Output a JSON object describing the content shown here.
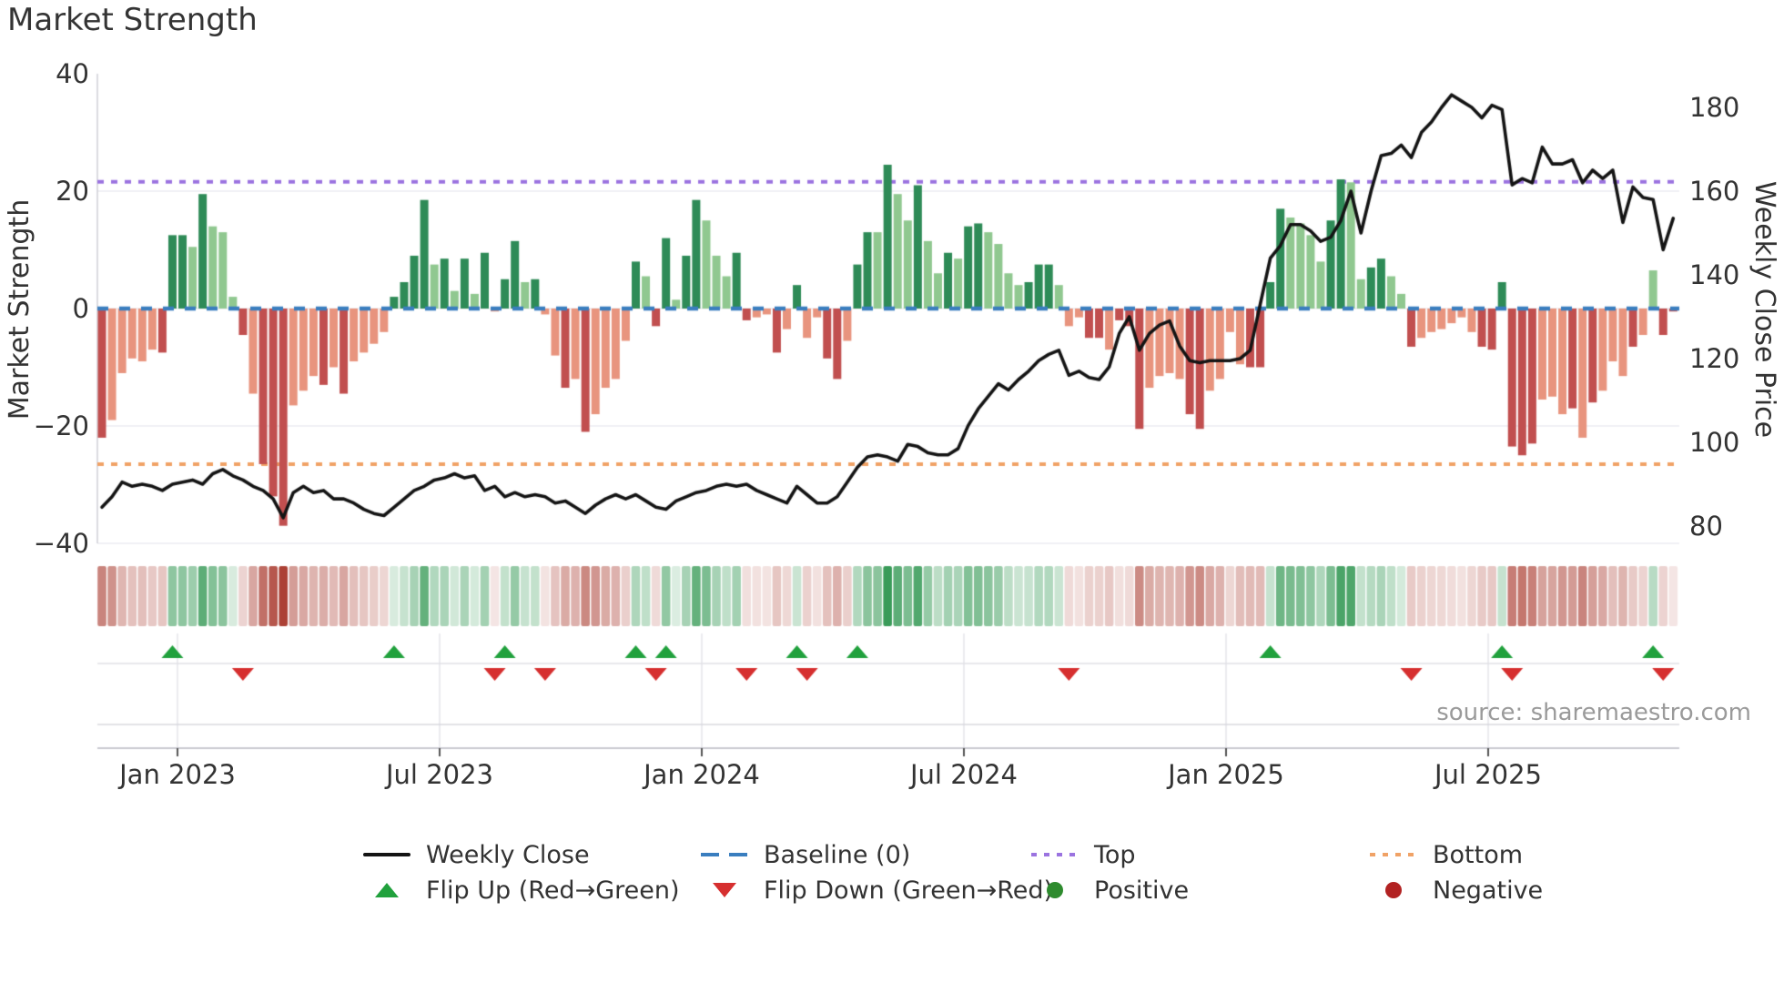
{
  "title": "Market Strength",
  "source": "source: sharemaestro.com",
  "axes": {
    "left_label": "Market Strength",
    "right_label": "Weekly Close Price",
    "left_ticks": [
      "40",
      "20",
      "0",
      "−20",
      "−40"
    ],
    "right_ticks": [
      "180",
      "160",
      "140",
      "120",
      "100",
      "80"
    ],
    "x_ticks": [
      "Jan 2023",
      "Jul 2023",
      "Jan 2024",
      "Jul 2024",
      "Jan 2025",
      "Jul 2025"
    ]
  },
  "legend": {
    "row1": [
      {
        "icon": "black-line",
        "label": "Weekly Close"
      },
      {
        "icon": "blue-dashes",
        "label": "Baseline (0)"
      },
      {
        "icon": "purple-dots",
        "label": "Top"
      },
      {
        "icon": "orange-dots",
        "label": "Bottom"
      }
    ],
    "row2": [
      {
        "icon": "green-triangle-up",
        "label": "Flip Up (Red→Green)"
      },
      {
        "icon": "red-triangle-down",
        "label": "Flip Down (Green→Red)"
      },
      {
        "icon": "green-circle",
        "label": "Positive"
      },
      {
        "icon": "red-circle",
        "label": "Negative"
      }
    ]
  },
  "colors": {
    "bar_pos_dark": "#2e8b57",
    "bar_pos_light": "#90c890",
    "bar_neg_dark": "#c14f4f",
    "bar_neg_light": "#e8947e",
    "price_line": "#141414",
    "baseline": "#3a7ebf",
    "top_line": "#9b73e0",
    "bottom_line": "#f0a266",
    "flip_up": "#21a13d",
    "flip_down": "#d62f2f",
    "grid": "#ebebf0",
    "spine": "#cfcfd6",
    "heat_pos": "#2f9650",
    "heat_neg": "#aa3d33"
  },
  "chart_data": {
    "type": [
      "bar",
      "line",
      "heatmap"
    ],
    "title": "Market Strength",
    "x_start_date": "2022-11-13",
    "x_step_days": 7,
    "x_tick_labels": [
      "Jan 2023",
      "Jul 2023",
      "Jan 2024",
      "Jul 2024",
      "Jan 2025",
      "Jul 2025"
    ],
    "ylabel": "Market Strength",
    "ylim": [
      -40,
      40
    ],
    "y2label": "Weekly Close Price",
    "y2lim": [
      76,
      188
    ],
    "baseline": 0,
    "top_line_value": 21.6,
    "bottom_line_value": -26.5,
    "legend_position": "bottom-center",
    "grid": true,
    "strength": [
      -22,
      -19,
      -11,
      -8.5,
      -9,
      -7,
      -7.5,
      12.5,
      12.5,
      10.5,
      19.5,
      14,
      13,
      2,
      -4.5,
      -14.5,
      -26.5,
      -32,
      -37,
      -16.5,
      -14,
      -11.5,
      -13,
      -10,
      -14.5,
      -9,
      -7.5,
      -6,
      -4,
      2,
      4.5,
      9,
      18.5,
      7.5,
      8.5,
      3,
      8.5,
      2.5,
      9.5,
      -0.5,
      5,
      11.5,
      4.5,
      5,
      -1,
      -8,
      -13.5,
      -12,
      -21,
      -18,
      -13.5,
      -12,
      -5.5,
      8,
      5.5,
      -3,
      12,
      1.5,
      9,
      18.5,
      15,
      9,
      5.5,
      9.5,
      -2,
      -1.5,
      -1,
      -7.5,
      -3.5,
      4,
      -5,
      -1.5,
      -8.5,
      -12,
      -5.5,
      7.5,
      13,
      13,
      24.5,
      19.5,
      15,
      21,
      11.5,
      6,
      9.5,
      8.5,
      14,
      14.5,
      13,
      11,
      6,
      4,
      4.5,
      7.5,
      7.5,
      4,
      -3,
      -1.5,
      -5,
      -5,
      -7,
      -2,
      -3,
      -20.5,
      -13.5,
      -11.5,
      -11,
      -12,
      -18,
      -20.5,
      -14,
      -12,
      -4,
      -9.5,
      -10,
      -10,
      4.5,
      17,
      15.5,
      14.5,
      12.5,
      8,
      15,
      22,
      21.5,
      5,
      7,
      8.5,
      5.5,
      2.5,
      -6.5,
      -5,
      -4,
      -3.5,
      -2.5,
      -1.5,
      -4,
      -6.5,
      -7,
      4.5,
      -23.5,
      -25,
      -23,
      -15.5,
      -15,
      -18,
      -17,
      -22,
      -16,
      -14,
      -9,
      -11.5,
      -6.5,
      -4.5,
      6.5,
      -4.5,
      -0.5
    ],
    "strength_shade": "dllllldddldllldldddllldldllllddddldldldlddldlldldlllldlddlddlllddlldldllddlddldlldlldlddlllldddlllddldddllllddllllddddllllddllddlldllllllddddddllldldllldllddl",
    "price": [
      84.5,
      87,
      90.5,
      89.5,
      90,
      89.5,
      88.5,
      90,
      90.5,
      91,
      90,
      92.5,
      93.5,
      92,
      91,
      89.5,
      88.5,
      86.5,
      82,
      88,
      89.5,
      88,
      88.5,
      86.5,
      86.5,
      85.5,
      84,
      83,
      82.5,
      84.5,
      86.5,
      88.5,
      89.5,
      91,
      91.5,
      92.5,
      91.5,
      92,
      88.5,
      89.5,
      87,
      88,
      87,
      87.5,
      87,
      85.5,
      86,
      84.5,
      83,
      85,
      86.5,
      87.5,
      86.5,
      87.5,
      86,
      84.5,
      84,
      86,
      87,
      88,
      88.5,
      89.5,
      90,
      89.5,
      90,
      88.5,
      87.5,
      86.5,
      85.5,
      89.5,
      87.5,
      85.5,
      85.5,
      87,
      90.5,
      94,
      96.5,
      97,
      96.5,
      95.5,
      99.5,
      99,
      97.5,
      97,
      97,
      98.5,
      104,
      108,
      111,
      114,
      112.5,
      115,
      117,
      119.5,
      121,
      122,
      116,
      117,
      115.5,
      115,
      118,
      126,
      130,
      122,
      126,
      128,
      129,
      123,
      119.5,
      119,
      119.5,
      119.5,
      119.5,
      120,
      122,
      133,
      144,
      147,
      152,
      152,
      150.5,
      148,
      149,
      153,
      160,
      150,
      160,
      168.5,
      169,
      171,
      168,
      174,
      176.5,
      180,
      183,
      181.5,
      180,
      177.5,
      180.5,
      179.5,
      161.5,
      163,
      162,
      170.5,
      166.5,
      166.5,
      167.5,
      162,
      165,
      163,
      165,
      152.5,
      161,
      158.5,
      158,
      146,
      153.5
    ],
    "flip_up_indices": [
      7,
      29,
      40,
      53,
      56,
      69,
      75,
      116,
      139,
      154
    ],
    "flip_down_indices": [
      14,
      39,
      44,
      55,
      64,
      70,
      96,
      130,
      140,
      155
    ]
  }
}
